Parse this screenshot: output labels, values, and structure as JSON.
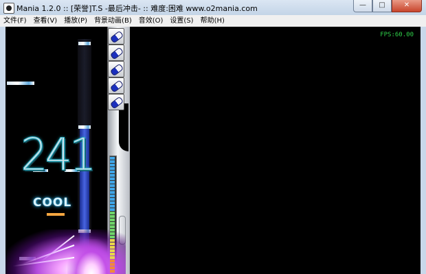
{
  "window": {
    "title": "Mania 1.2.0 :: [荣誉]T.S -最后冲击- :: 难度:困难 www.o2mania.com",
    "minimize_glyph": "—",
    "maximize_glyph": "□",
    "close_glyph": "✕"
  },
  "menu": {
    "items": [
      "文件(F)",
      "查看(V)",
      "播放(P)",
      "背景动画(B)",
      "音效(O)",
      "设置(S)",
      "帮助(H)"
    ]
  },
  "game": {
    "fps_text": "FPS:60.00",
    "combo": "241",
    "judgement": "COOL",
    "keys": [
      {
        "icon": "blue-white-capsule-icon"
      },
      {
        "icon": "blue-white-capsule-icon"
      },
      {
        "icon": "blue-white-capsule-icon"
      },
      {
        "icon": "blue-white-capsule-icon"
      },
      {
        "icon": "blue-white-capsule-icon"
      }
    ],
    "colors": {
      "fps": "#2fd04a",
      "lane_glow": "#4c6cf5",
      "judgement_glow": "#35c9ff",
      "hit_burst": "#b34bdc"
    }
  }
}
